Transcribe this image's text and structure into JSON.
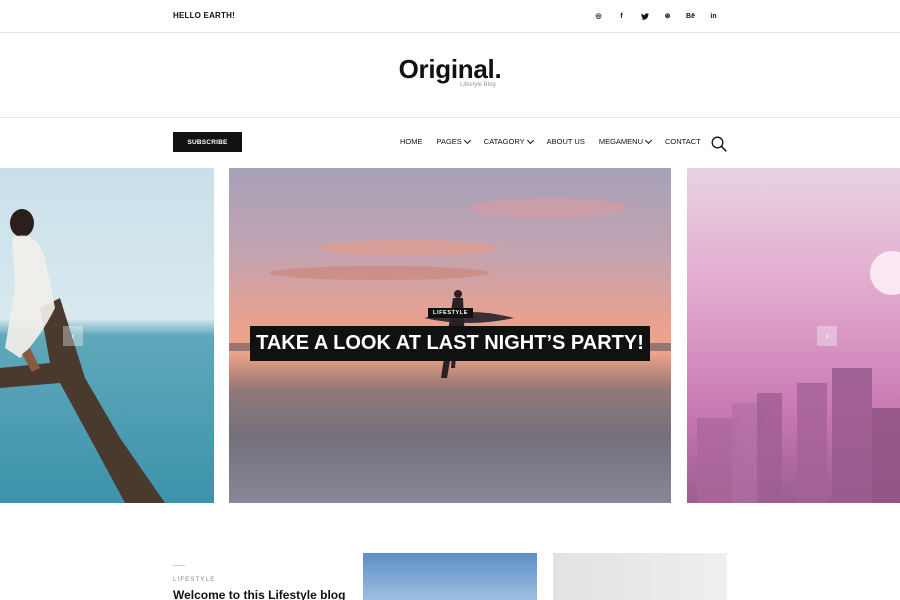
{
  "topbar": {
    "greeting": "HELLO EARTH!",
    "socials": [
      {
        "icon": "pinterest-icon",
        "glyph": "◎"
      },
      {
        "icon": "facebook-icon",
        "glyph": "f"
      },
      {
        "icon": "twitter-icon",
        "glyph": "🐦"
      },
      {
        "icon": "dribbble-icon",
        "glyph": "⊛"
      },
      {
        "icon": "behance-icon",
        "glyph": "Bē"
      },
      {
        "icon": "linkedin-icon",
        "glyph": "in"
      }
    ]
  },
  "logo": {
    "title": "Original.",
    "tagline": "Lifestyle Blog"
  },
  "nav": {
    "subscribe_label": "SUBSCRIBE",
    "items": [
      {
        "label": "HOME",
        "dropdown": false
      },
      {
        "label": "PAGES",
        "dropdown": true
      },
      {
        "label": "CATAGORY",
        "dropdown": true
      },
      {
        "label": "ABOUT US",
        "dropdown": false
      },
      {
        "label": "MEGAMENU",
        "dropdown": true
      },
      {
        "label": "CONTACT",
        "dropdown": false
      }
    ]
  },
  "slider": {
    "badge": "LIFESTYLE",
    "headline": "TAKE A LOOK AT LAST NIGHT’S PARTY!",
    "prev_glyph": "‹",
    "next_glyph": "›"
  },
  "featured": {
    "category": "LIFESTYLE",
    "title": "Welcome to this Lifestyle blog"
  }
}
